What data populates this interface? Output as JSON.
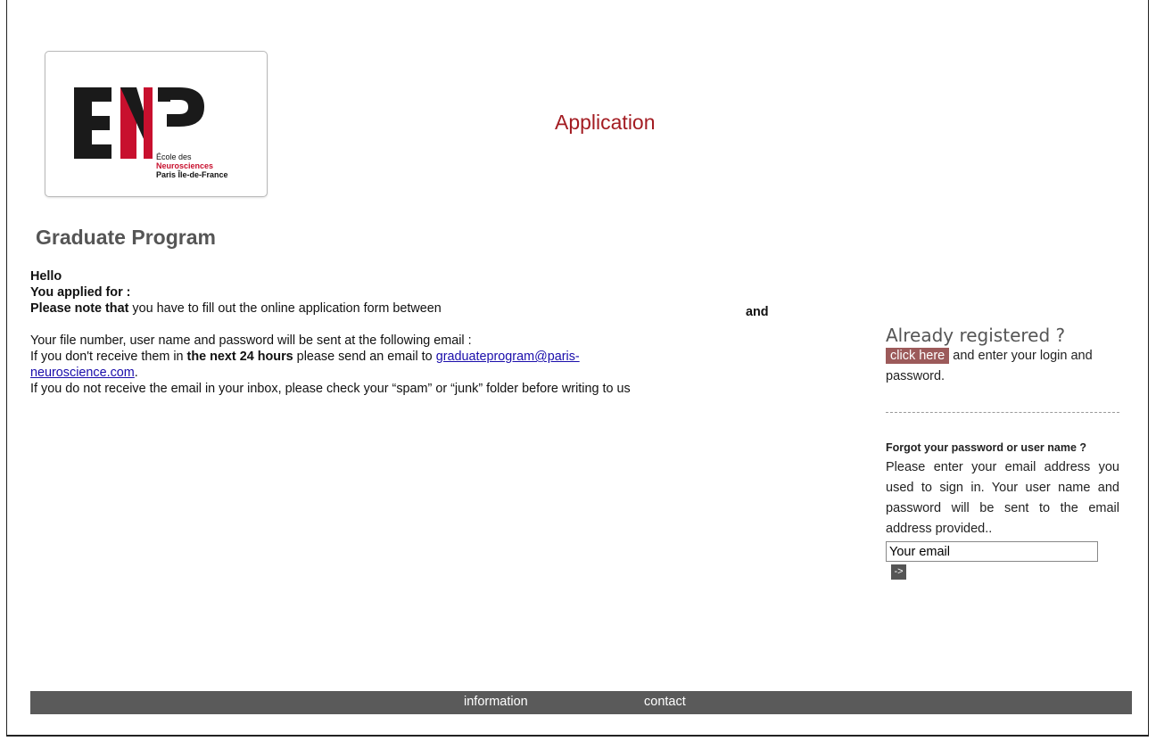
{
  "logo": {
    "line1": "École des",
    "line2": "Neurosciences",
    "line3": "Paris Île-de-France"
  },
  "header": {
    "title": "Application"
  },
  "program": {
    "title": "Graduate Program"
  },
  "main": {
    "hello": "Hello",
    "applied_for": "You applied for :",
    "please_note": "Please note that",
    "fill_text": " you have to fill out the online application form between",
    "and": "and",
    "file_number_text": "Your file number, user name and password will be sent at the following email :",
    "no_receive_prefix": "If you don't receive them in ",
    "next_24": "the next 24 hours",
    "no_receive_mid": " please send an email to ",
    "email_link": "graduateprogram@paris-neuroscience.com",
    "email_link_part1": "graduateprogram@paris-",
    "email_link_part2": "neuroscience.com",
    "period": ".",
    "spam_text": "If you do not receive the email in your inbox, please check your “spam” or “junk” folder before writing to us"
  },
  "sidebar": {
    "already_registered": "Already registered ?",
    "click_here": "click here",
    "login_text": " and enter your login and password.",
    "forgot_title": "Forgot your password or user name ?",
    "forgot_body": "Please enter your email address you used to sign in. Your user name and password will be sent to the email address provided..",
    "email_value": "Your email",
    "go_label": "->"
  },
  "footer": {
    "information": "information",
    "contact": "contact"
  },
  "colors": {
    "title_red": "#a31c22",
    "click_here_bg": "#9c5a5a",
    "footer_bg": "#5a5a5a",
    "logo_red": "#c8102e"
  }
}
